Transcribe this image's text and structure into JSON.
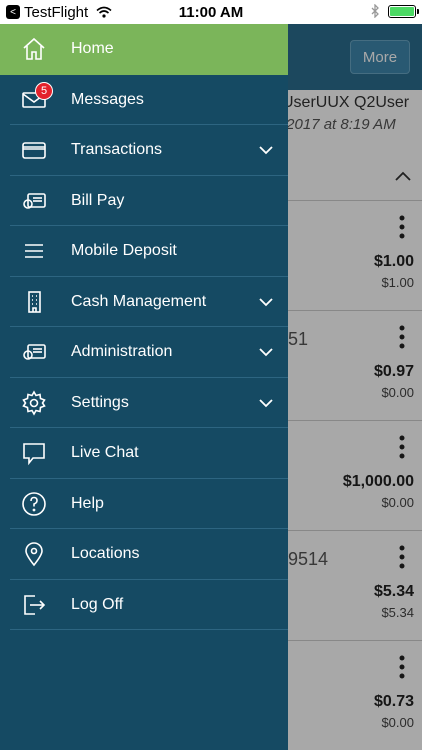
{
  "statusbar": {
    "back_glyph": "<",
    "app": "TestFlight",
    "time": "11:00 AM",
    "battery_level": 1.0,
    "battery_color": "#4cd964"
  },
  "drawer": {
    "background": "#154a63",
    "active_color": "#7bb55a",
    "items": [
      {
        "label": "Home",
        "icon": "home-icon",
        "active": true
      },
      {
        "label": "Messages",
        "icon": "envelope-icon",
        "badge": "5"
      },
      {
        "label": "Transactions",
        "icon": "credit-card-icon",
        "expandable": true
      },
      {
        "label": "Bill Pay",
        "icon": "bill-pay-icon"
      },
      {
        "label": "Mobile Deposit",
        "icon": "menu-lines-icon"
      },
      {
        "label": "Cash Management",
        "icon": "building-icon",
        "expandable": true
      },
      {
        "label": "Administration",
        "icon": "admin-card-icon",
        "expandable": true
      },
      {
        "label": "Settings",
        "icon": "gear-icon",
        "expandable": true
      },
      {
        "label": "Live Chat",
        "icon": "chat-bubble-icon"
      },
      {
        "label": "Help",
        "icon": "help-icon"
      },
      {
        "label": "Locations",
        "icon": "location-pin-icon"
      },
      {
        "label": "Log Off",
        "icon": "log-off-icon"
      }
    ]
  },
  "background": {
    "more_button": "More",
    "user_fragment": "UserUUX Q2User",
    "date_fragment": "/2017 at 8:19 AM",
    "transactions": [
      {
        "amount": "$1.00",
        "balance": "$1.00",
        "fragment": ""
      },
      {
        "amount": "$0.97",
        "balance": "$0.00",
        "fragment": "51"
      },
      {
        "amount": "$1,000.00",
        "balance": "$0.00",
        "fragment": ""
      },
      {
        "amount": "$5.34",
        "balance": "$5.34",
        "fragment": "9514"
      },
      {
        "amount": "$0.73",
        "balance": "$0.00",
        "fragment": ""
      }
    ]
  }
}
